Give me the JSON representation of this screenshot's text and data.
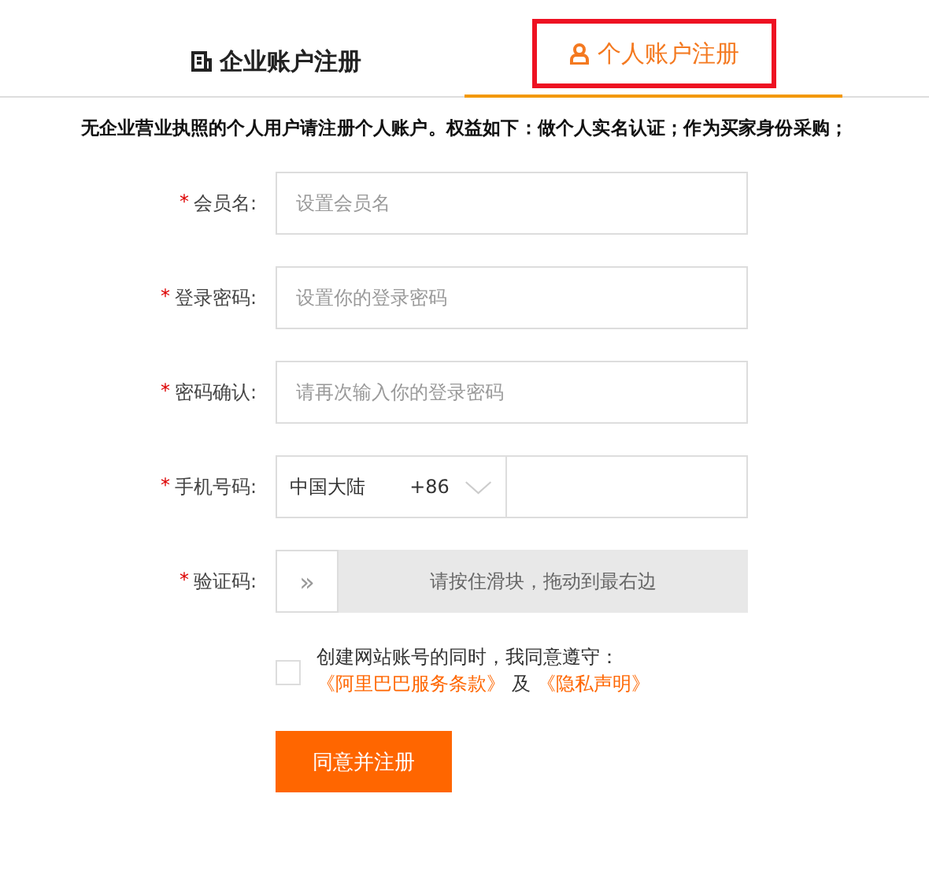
{
  "tabs": [
    {
      "label": "企业账户注册",
      "selected": false,
      "highlighted": false
    },
    {
      "label": "个人账户注册",
      "selected": true,
      "highlighted": true
    }
  ],
  "notice": "无企业营业执照的个人用户请注册个人账户。权益如下：做个人实名认证；作为买家身份采购；",
  "fields": [
    {
      "kind": "text",
      "required_mark": "*",
      "label": "会员名:",
      "placeholder": "设置会员名"
    },
    {
      "kind": "text",
      "required_mark": "*",
      "label": "登录密码:",
      "placeholder": "设置你的登录密码"
    },
    {
      "kind": "text",
      "required_mark": "*",
      "label": "密码确认:",
      "placeholder": "请再次输入你的登录密码"
    },
    {
      "kind": "phone",
      "required_mark": "*",
      "label": "手机号码:",
      "region": "中国大陆",
      "code": "+86"
    },
    {
      "kind": "slider",
      "required_mark": "*",
      "label": "验证码:",
      "handle": "»",
      "hint": "请按住滑块，拖动到最右边"
    }
  ],
  "agreement": {
    "checked": false,
    "text": "创建网站账号的同时，我同意遵守：",
    "link_1": "《阿里巴巴服务条款》",
    "joiner": "及",
    "link_2": "《隐私声明》"
  },
  "submit": "同意并注册"
}
